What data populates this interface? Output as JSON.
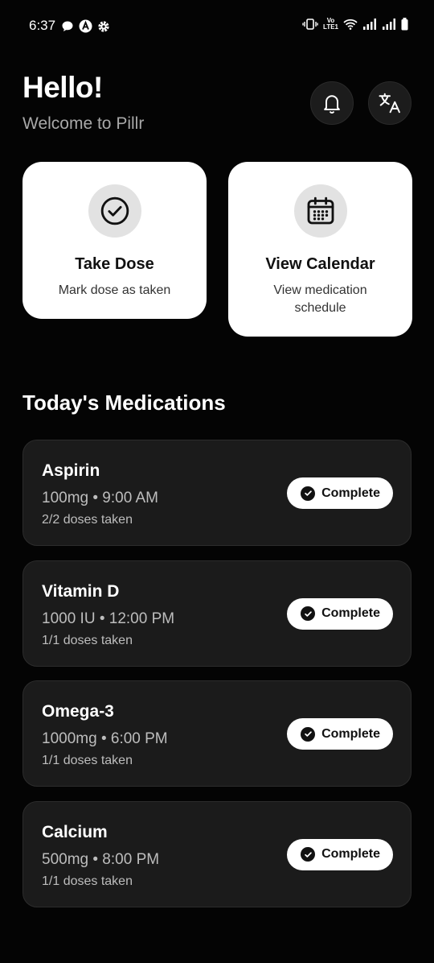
{
  "status_bar": {
    "time": "6:37",
    "left_icons": [
      "chat-bubble-icon",
      "app-a-icon",
      "settings-gear-icon"
    ],
    "right_icons": [
      "vibrate-icon",
      "volte-icon",
      "wifi-icon",
      "signal-icon",
      "signal-icon",
      "battery-icon"
    ],
    "volte_label": "VoLTE1"
  },
  "header": {
    "greeting": "Hello!",
    "subtitle": "Welcome to Pillr",
    "buttons": [
      "bell-icon",
      "translate-icon"
    ]
  },
  "actions": [
    {
      "icon": "check-circle-icon",
      "title": "Take Dose",
      "description": "Mark dose as taken"
    },
    {
      "icon": "calendar-icon",
      "title": "View Calendar",
      "description": "View medication schedule"
    }
  ],
  "section_title": "Today's Medications",
  "medications": [
    {
      "name": "Aspirin",
      "detail": "100mg • 9:00 AM",
      "doses": "2/2 doses taken",
      "status": "Complete"
    },
    {
      "name": "Vitamin D",
      "detail": "1000 IU • 12:00 PM",
      "doses": "1/1 doses taken",
      "status": "Complete"
    },
    {
      "name": "Omega-3",
      "detail": "1000mg • 6:00 PM",
      "doses": "1/1 doses taken",
      "status": "Complete"
    },
    {
      "name": "Calcium",
      "detail": "500mg • 8:00 PM",
      "doses": "1/1 doses taken",
      "status": "Complete"
    }
  ],
  "colors": {
    "background": "#040404",
    "card": "#1b1b1b",
    "action_card": "#ffffff",
    "muted_text": "#a8a8a8"
  }
}
